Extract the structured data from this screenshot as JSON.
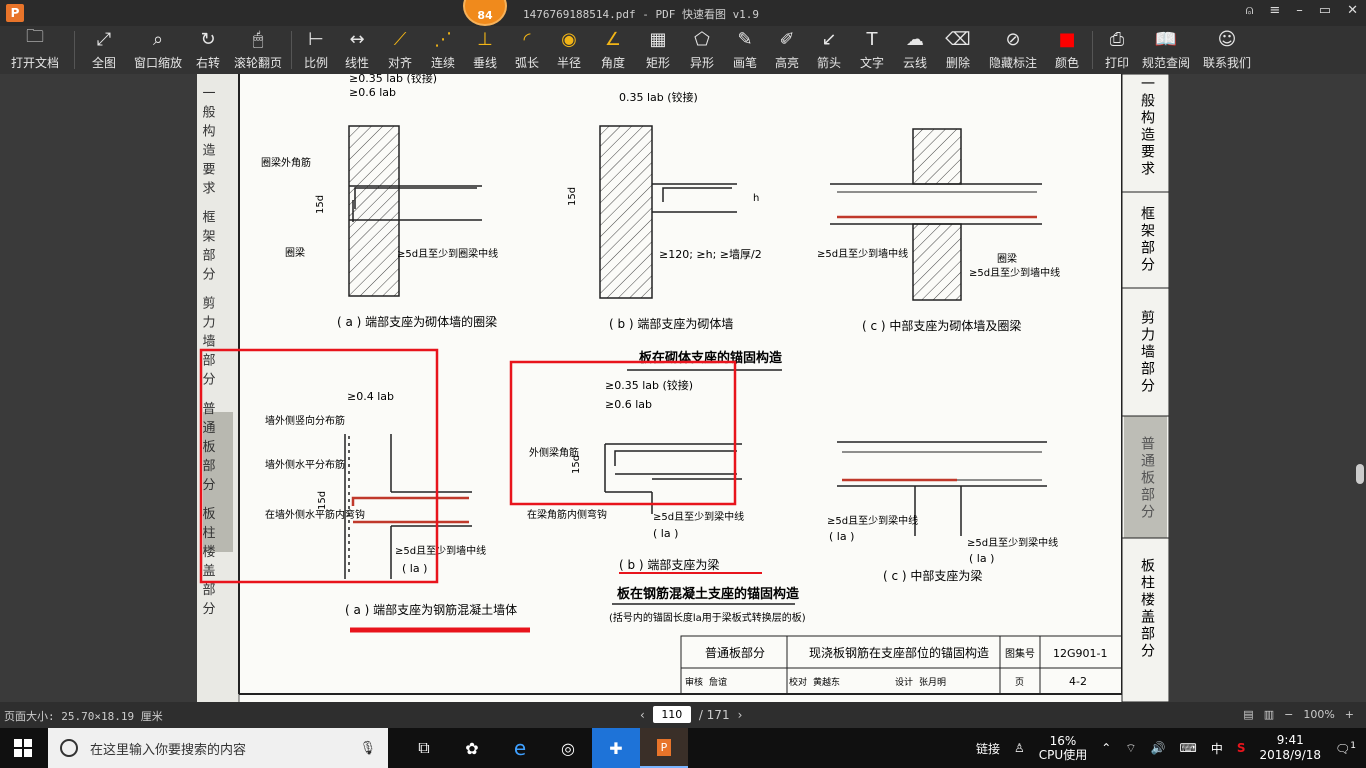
{
  "window": {
    "title": "1476769188514.pdf - PDF 快速看图 v1.9",
    "badge": "84",
    "logo": "P",
    "controls": [
      "user-icon",
      "menu-icon",
      "minimize-icon",
      "maximize-icon",
      "close-icon"
    ]
  },
  "toolbar": [
    {
      "label": "打开文档",
      "icon": "folder-icon"
    },
    {
      "label": "全图",
      "icon": "fit-icon"
    },
    {
      "label": "窗口缩放",
      "icon": "zoom-icon"
    },
    {
      "label": "右转",
      "icon": "rotate-icon"
    },
    {
      "label": "滚轮翻页",
      "icon": "mouse-icon"
    },
    {
      "label": "比例",
      "icon": "scale-icon"
    },
    {
      "label": "线性",
      "icon": "linear-icon"
    },
    {
      "label": "对齐",
      "icon": "align-icon"
    },
    {
      "label": "连续",
      "icon": "continuous-icon"
    },
    {
      "label": "垂线",
      "icon": "perpendicular-icon"
    },
    {
      "label": "弧长",
      "icon": "arc-icon"
    },
    {
      "label": "半径",
      "icon": "radius-icon"
    },
    {
      "label": "角度",
      "icon": "angle-icon"
    },
    {
      "label": "矩形",
      "icon": "rect-icon"
    },
    {
      "label": "异形",
      "icon": "polygon-icon"
    },
    {
      "label": "画笔",
      "icon": "pen-icon"
    },
    {
      "label": "高亮",
      "icon": "highlight-icon"
    },
    {
      "label": "箭头",
      "icon": "arrow-icon"
    },
    {
      "label": "文字",
      "icon": "text-icon"
    },
    {
      "label": "云线",
      "icon": "cloud-icon"
    },
    {
      "label": "删除",
      "icon": "eraser-icon"
    },
    {
      "label": "隐藏标注",
      "icon": "hide-icon"
    },
    {
      "label": "颜色",
      "icon": "color-icon"
    },
    {
      "label": "打印",
      "icon": "print-icon"
    },
    {
      "label": "规范查阅",
      "icon": "book-icon"
    },
    {
      "label": "联系我们",
      "icon": "contact-icon"
    }
  ],
  "document": {
    "side_tabs": [
      "一般构造要求",
      "框架部分",
      "剪力墙部分",
      "普通板部分",
      "板柱楼盖部分"
    ],
    "left_spine": "一般构造要求 框架部分 剪力墙部分 普通板部分 板柱楼盖部分",
    "captions": {
      "a_top": "( a ) 端部支座为砌体墙的圈梁",
      "b_top": "( b ) 端部支座为砌体墙",
      "c_top": "( c ) 中部支座为砌体墙及圈梁",
      "section_top": "板在砌体支座的锚固构造",
      "a_bottom": "( a ) 端部支座为钢筋混凝土墙体",
      "b_bottom": "( b ) 端部支座为梁",
      "c_bottom": "( c ) 中部支座为梁",
      "section_bottom": "板在钢筋混凝土支座的锚固构造",
      "note_bottom": "(括号内的锚固长度la用于梁板式转换层的板)"
    },
    "labels": {
      "a035": "≥0.35 lab (铰接)",
      "a06": "≥0.6 lab",
      "quanliang_corner": "圈梁外角筋",
      "quanliang": "圈梁",
      "d15": "15d",
      "a_5d": "≥5d且至少到圈梁中线",
      "b035": "0.35 lab (铰接)",
      "b_h": "h",
      "b_120": "≥120; ≥h; ≥墙厚/2",
      "c_5d_left": "≥5d且至少到墙中线",
      "c_quanliang": "圈梁",
      "c_5d_right": "≥5d且至少到墙中线",
      "ra_04": "≥0.4 lab",
      "ra_vert": "墙外侧竖向分布筋",
      "ra_horiz": "墙外侧水平分布筋",
      "ra_inner": "在墙外侧水平筋内弯钩",
      "ra_5d": "≥5d且至少到墙中线",
      "ra_la": "( la )",
      "rb_035": "≥0.35 lab (铰接)",
      "rb_06": "≥0.6 lab",
      "rb_corner": "外侧梁角筋",
      "rb_inner": "在梁角筋内侧弯钩",
      "rb_5d": "≥5d且至少到梁中线",
      "rb_la": "( la )",
      "rc_5d_left": "≥5d且至少到梁中线",
      "rc_la_left": "( la )",
      "rc_5d_right": "≥5d且至少到梁中线",
      "rc_la_right": "( la )"
    },
    "titleblock": {
      "part": "普通板部分",
      "title": "现浇板钢筋在支座部位的锚固构造",
      "atlas_label": "图集号",
      "atlas_no": "12G901-1",
      "page_label": "页",
      "page_no": "4-2",
      "review_label": "审核",
      "reviewer": "詹谊",
      "check_label": "校对",
      "checker": "黄越东",
      "design_label": "设计",
      "designer": "张月明"
    }
  },
  "status": {
    "page_size": "页面大小: 25.70×18.19 厘米",
    "current_page": "110",
    "total_pages": "/ 171",
    "zoom": "100%"
  },
  "taskbar": {
    "search_placeholder": "在这里输入你要搜索的内容",
    "link_label": "链接",
    "cpu_percent": "16%",
    "cpu_label": "CPU使用",
    "ime": "中",
    "time": "9:41",
    "date": "2018/9/18",
    "notifications": "1"
  },
  "colors": {
    "annotation_red": "#e8141c",
    "accent_orange": "#f08a1c",
    "color_swatch": "#ff0000"
  }
}
